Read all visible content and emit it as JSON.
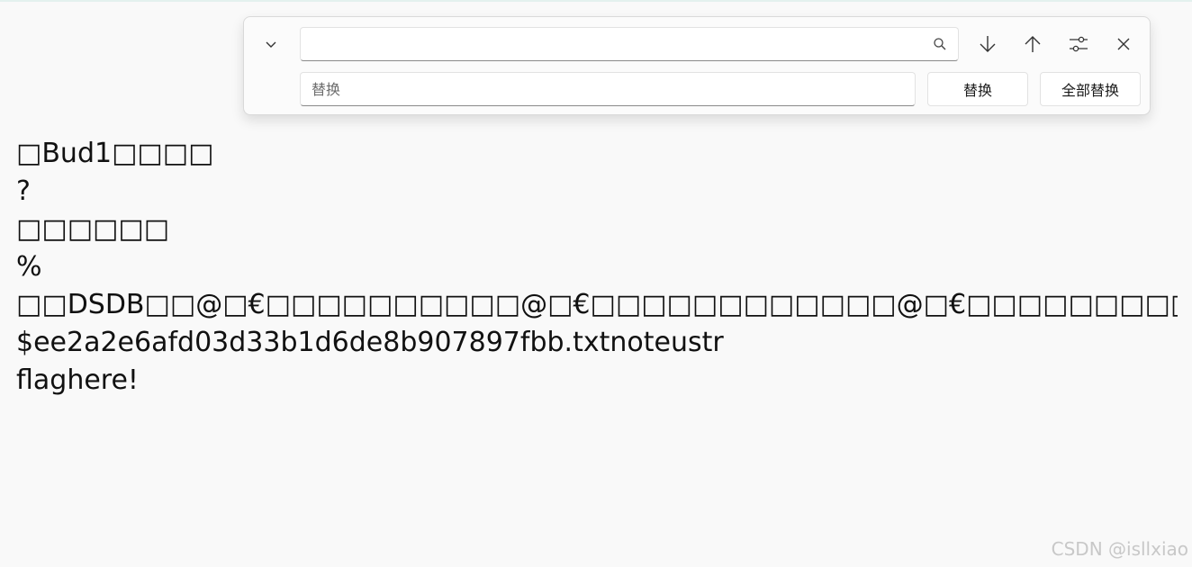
{
  "find_panel": {
    "find_value": "",
    "replace_placeholder": "替换",
    "replace_label": "替换",
    "replace_all_label": "全部替换",
    "icons": {
      "toggle": "chevron-down-icon",
      "search": "search-icon",
      "next": "arrow-down-icon",
      "previous": "arrow-up-icon",
      "options": "sliders-icon",
      "close": "close-icon"
    }
  },
  "document": {
    "lines": [
      "□Bud1□□□□",
      "?",
      "□□□□□□",
      "%",
      "□□DSDB□□@□€□□□□□□□□□□@□€□□□□□□□□□□□□@□€□□□□□□□□□□□□@□",
      "$ee2a2e6afd03d33b1d6de8b907897fbb.txtnoteustr",
      "flaghere!"
    ]
  },
  "watermark": "CSDN @isllxiao",
  "colors": {
    "background": "#f9f9f9",
    "panel": "#fbfbfb",
    "text": "#111111",
    "watermark": "#c8c8c8"
  }
}
